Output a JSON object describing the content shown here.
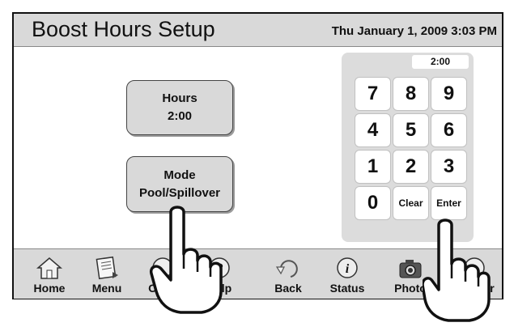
{
  "header": {
    "title": "Boost Hours Setup",
    "datetime": "Thu January 1, 2009  3:03 PM"
  },
  "main": {
    "hours_button": {
      "label": "Hours",
      "value": "2:00"
    },
    "mode_button": {
      "label": "Mode",
      "value": "Pool/Spillover"
    }
  },
  "keypad": {
    "display": "2:00",
    "keys": [
      "7",
      "8",
      "9",
      "4",
      "5",
      "6",
      "1",
      "2",
      "3",
      "0",
      "Clear",
      "Enter"
    ]
  },
  "navbar": {
    "items": [
      {
        "label": "Home",
        "icon": "house-icon"
      },
      {
        "label": "Menu",
        "icon": "notepad-icon"
      },
      {
        "label": "OneT",
        "icon": "onetouch-icon"
      },
      {
        "label": "Help",
        "icon": "question-icon"
      },
      {
        "label": "Back",
        "icon": "back-arrow-icon"
      },
      {
        "label": "Status",
        "icon": "info-icon"
      },
      {
        "label": "Photo",
        "icon": "camera-icon"
      },
      {
        "label": "r",
        "icon": "power-icon"
      }
    ]
  },
  "colors": {
    "panel_gray": "#d9d9d9",
    "keypad_gray": "#dcdcdc",
    "outline": "#111111"
  }
}
